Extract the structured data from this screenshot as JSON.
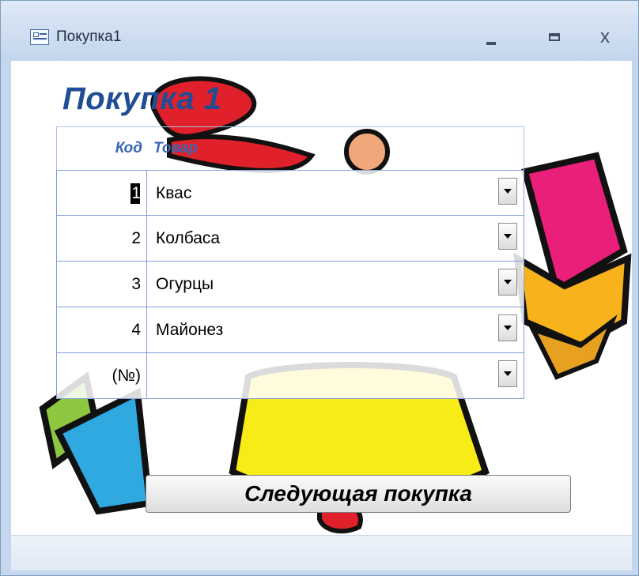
{
  "window": {
    "title": "Покупка1"
  },
  "form": {
    "title": "Покупка 1",
    "columns": {
      "code": "Код",
      "item": "Товар"
    },
    "rows": [
      {
        "code": "1",
        "item": "Квас"
      },
      {
        "code": "2",
        "item": "Колбаса"
      },
      {
        "code": "3",
        "item": "Огурцы"
      },
      {
        "code": "4",
        "item": "Майонез"
      },
      {
        "code": "(№)",
        "item": ""
      }
    ],
    "next_button": "Следующая покупка"
  },
  "colors": {
    "title_blue": "#1f4e96",
    "header_blue": "#3a67b4",
    "grid_border": "#7f9ed9"
  },
  "icons": [
    "form-icon",
    "minimize-icon",
    "maximize-icon",
    "close-icon",
    "dropdown-arrow-icon"
  ]
}
